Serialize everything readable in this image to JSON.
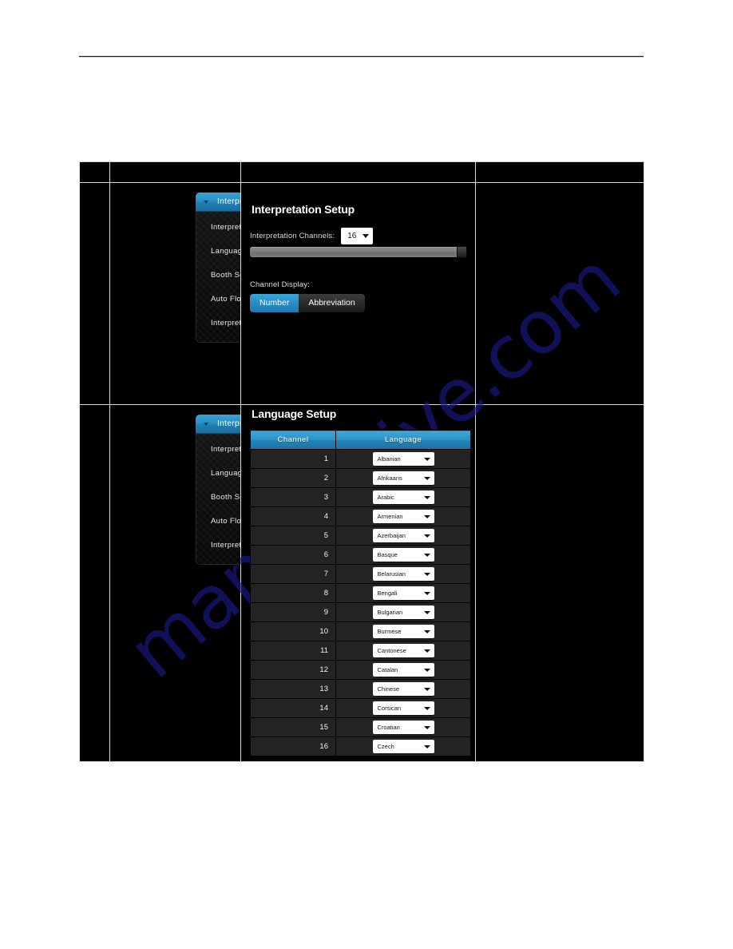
{
  "watermark": {
    "text": "manualslive.com"
  },
  "sidebar": {
    "header_label": "Interpretation",
    "items": [
      {
        "label": "Interpreter Channels"
      },
      {
        "label": "Language Setup"
      },
      {
        "label": "Booth Setup"
      },
      {
        "label": "Auto Floor"
      },
      {
        "label": "Interpreter Lock"
      }
    ]
  },
  "interpretation_setup": {
    "title": "Interpretation Setup",
    "channels_label": "Interpretation Channels:",
    "channels_value": "16",
    "slider_position_percent": 100,
    "channel_display_label": "Channel Display:",
    "toggle": {
      "number_label": "Number",
      "abbreviation_label": "Abbreviation",
      "selected": "Number"
    }
  },
  "language_setup": {
    "title": "Language Setup",
    "columns": [
      "Channel",
      "Language"
    ],
    "rows": [
      {
        "channel": "1",
        "language": "Albanian"
      },
      {
        "channel": "2",
        "language": "Afrikaans"
      },
      {
        "channel": "3",
        "language": "Arabic"
      },
      {
        "channel": "4",
        "language": "Armenian"
      },
      {
        "channel": "5",
        "language": "Azerbaijan"
      },
      {
        "channel": "6",
        "language": "Basque"
      },
      {
        "channel": "7",
        "language": "Belarusian"
      },
      {
        "channel": "8",
        "language": "Bengali"
      },
      {
        "channel": "9",
        "language": "Bulgarian"
      },
      {
        "channel": "10",
        "language": "Burmese"
      },
      {
        "channel": "11",
        "language": "Cantonese"
      },
      {
        "channel": "12",
        "language": "Catalan"
      },
      {
        "channel": "13",
        "language": "Chinese"
      },
      {
        "channel": "14",
        "language": "Corsican"
      },
      {
        "channel": "15",
        "language": "Croatian"
      },
      {
        "channel": "16",
        "language": "Czech"
      }
    ]
  },
  "colors": {
    "accent_blue": "#2a8cc2",
    "panel_black": "#000000",
    "row_dark": "#232323",
    "grid_line": "#d9dadc",
    "watermark_blue": "#1b1c8f"
  }
}
